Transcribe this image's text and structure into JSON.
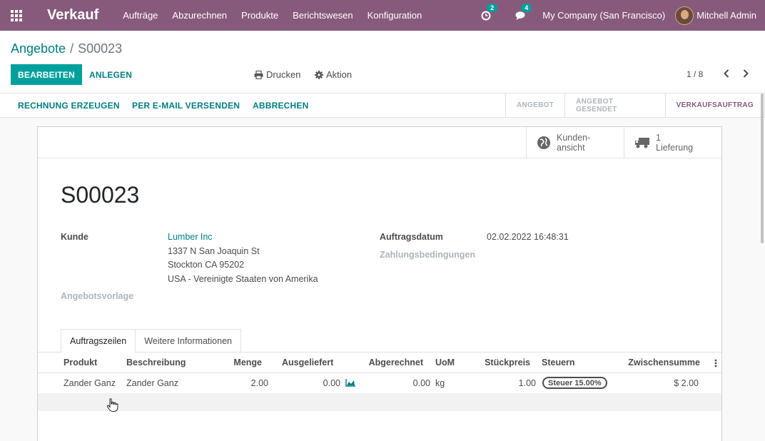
{
  "navbar": {
    "app_name": "Verkauf",
    "menu": [
      "Aufträge",
      "Abzurechnen",
      "Produkte",
      "Berichtswesen",
      "Konfiguration"
    ],
    "activity_count": "2",
    "messages_count": "4",
    "company": "My Company (San Francisco)",
    "user": "Mitchell Admin",
    "colors": {
      "primary": "#875a7b",
      "badge": "#00a09d"
    }
  },
  "breadcrumb": {
    "parent": "Angebote",
    "separator": "/",
    "current": "S00023"
  },
  "toolbar": {
    "edit_label": "BEARBEITEN",
    "create_label": "ANLEGEN",
    "print_label": "Drucken",
    "action_label": "Aktion",
    "pager": "1 / 8"
  },
  "statusbar": {
    "buttons": [
      "RECHNUNG ERZEUGEN",
      "PER E-MAIL VERSENDEN",
      "ABBRECHEN"
    ],
    "steps": [
      "ANGEBOT",
      "ANGEBOT GESENDET",
      "VERKAUFSAUFTRAG"
    ],
    "active_step": "VERKAUFSAUFTRAG"
  },
  "smart_buttons": {
    "customer_view_l1": "Kunden-",
    "customer_view_l2": "ansicht",
    "delivery_count": "1",
    "delivery_label": "Lieferung"
  },
  "form": {
    "name": "S00023",
    "customer_label": "Kunde",
    "customer_name": "Lumber Inc",
    "address_line1": "1337 N San Joaquin St",
    "address_line2": "Stockton CA 95202",
    "address_line3": "USA - Vereinigte Staaten von Amerika",
    "template_label": "Angebotsvorlage",
    "order_date_label": "Auftragsdatum",
    "order_date": "02.02.2022 16:48:31",
    "payment_terms_label": "Zahlungsbedingungen"
  },
  "tabs": [
    "Auftragszeilen",
    "Weitere Informationen"
  ],
  "order_lines": {
    "columns": [
      "Produkt",
      "Beschreibung",
      "Menge",
      "Ausgeliefert",
      "Abgerechnet",
      "UoM",
      "Stückpreis",
      "Steuern",
      "Zwischensumme"
    ],
    "rows": [
      {
        "product": "Zander Ganz",
        "description": "Zander Ganz",
        "qty": "2.00",
        "delivered": "0.00",
        "invoiced": "0.00",
        "uom": "kg",
        "price": "1.00",
        "tax": "Steuer 15.00%",
        "subtotal": "$ 2.00"
      }
    ]
  }
}
